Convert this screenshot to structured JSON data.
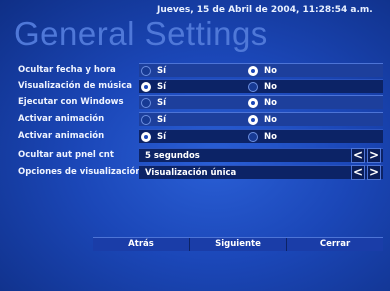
{
  "header": {
    "datetime": "Jueves, 15 de Abril de 2004, 11:28:54 a.m.",
    "title": "General Settings"
  },
  "settings": [
    {
      "label": "Ocultar fecha y hora",
      "options": [
        "Sí",
        "No"
      ],
      "selected": "No"
    },
    {
      "label": "Visualización de música",
      "options": [
        "Sí",
        "No"
      ],
      "selected": "Sí"
    },
    {
      "label": "Ejecutar con Windows",
      "options": [
        "Sí",
        "No"
      ],
      "selected": "No"
    },
    {
      "label": "Activar animación",
      "options": [
        "Sí",
        "No"
      ],
      "selected": "No"
    },
    {
      "label": "Activar animación",
      "options": [
        "Sí",
        "No"
      ],
      "selected": "Sí"
    }
  ],
  "selectors": [
    {
      "label": "Ocultar aut pnel cnt",
      "value": "5 segundos",
      "prev": "<",
      "next": ">"
    },
    {
      "label": "Opciones de visualización",
      "value": "Visualización única",
      "prev": "<",
      "next": ">"
    }
  ],
  "buttons": {
    "back": "Atrás",
    "next": "Siguiente",
    "close": "Cerrar"
  }
}
